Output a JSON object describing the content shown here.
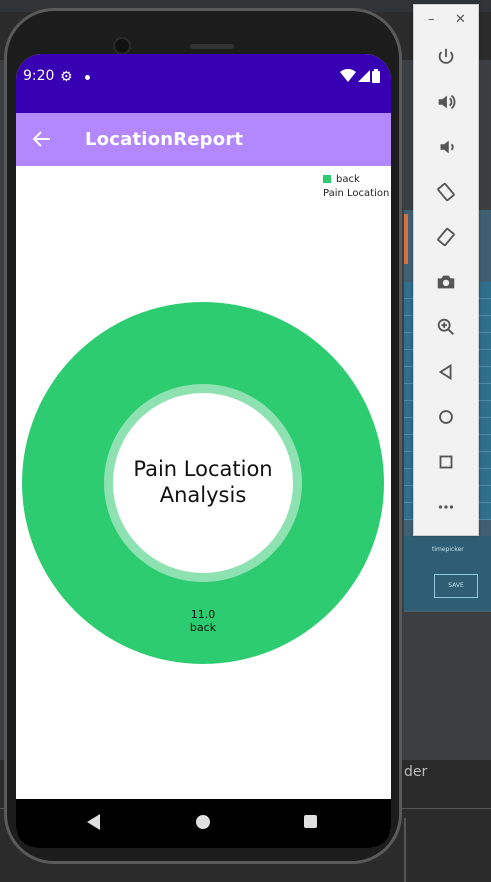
{
  "status_bar": {
    "time": "9:20"
  },
  "app_bar": {
    "title": "LocationReport"
  },
  "chart_data": {
    "type": "pie",
    "style": "donut",
    "center_text": "Pain Location Analysis",
    "legend": {
      "position": "top-right",
      "title": "Pain Location",
      "entries": [
        "back"
      ]
    },
    "slices": [
      {
        "label": "back",
        "value": 11.0,
        "value_label": "11.0",
        "color": "#2ecc71"
      }
    ]
  },
  "ide": {
    "bottom_label": "der",
    "preview_label": "timepicker",
    "preview_button": "SAVE"
  },
  "colors": {
    "status_bar": "#3700b3",
    "app_bar": "#b388ff",
    "slice": "#2ecc71"
  }
}
